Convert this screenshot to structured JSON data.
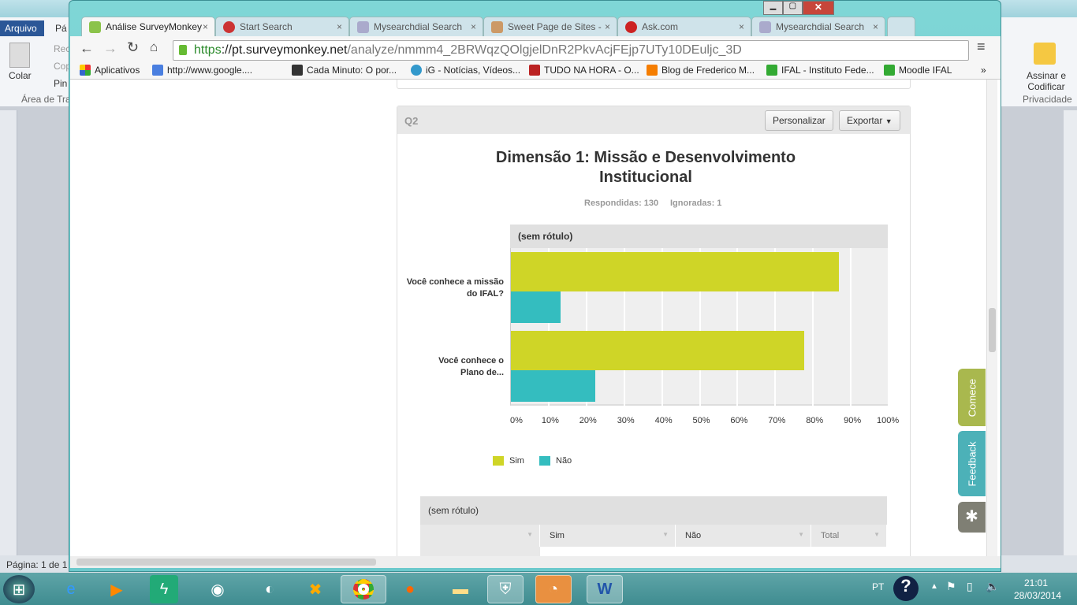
{
  "word": {
    "file_tab": "Arquivo",
    "home_tab": "Pá",
    "paste": "Colar",
    "cut": "Rec",
    "copy": "Cop",
    "painter": "Pin",
    "clipboard_group": "Área de Tra",
    "sign_encode": "Assinar e Codificar",
    "privacy_group": "Privacidade",
    "status_page": "Página: 1 de 1"
  },
  "browser": {
    "tabs": [
      {
        "label": "Análise SurveyMonkey",
        "active": true,
        "icon": "surveymonkey-icon"
      },
      {
        "label": "Start Search",
        "active": false,
        "icon": "start-search-icon"
      },
      {
        "label": "Mysearchdial Search",
        "active": false,
        "icon": "magnifier-icon"
      },
      {
        "label": "Sweet Page de Sites -",
        "active": false,
        "icon": "sweetpage-icon"
      },
      {
        "label": "Ask.com",
        "active": false,
        "icon": "ask-icon"
      },
      {
        "label": "Mysearchdial Search",
        "active": false,
        "icon": "magnifier-icon"
      }
    ],
    "url_scheme": "https",
    "url_host": "://pt.surveymonkey.net",
    "url_path": "/analyze/nmmm4_2BRWqzQOlgjelDnR2PkvAcjFEjp7UTy10DEuljc_3D",
    "bookmarks": [
      "Aplicativos",
      "http://www.google....",
      "Cada Minuto: O por...",
      "iG - Notícias, Vídeos...",
      "TUDO NA HORA - O...",
      "Blog de Frederico M...",
      "IFAL - Instituto Fede...",
      "Moodle IFAL"
    ]
  },
  "question": {
    "id": "Q2",
    "customize": "Personalizar",
    "export": "Exportar",
    "answered": "Respondidas: 130",
    "skipped": "Ignoradas: 1"
  },
  "chart_data": {
    "type": "bar",
    "orientation": "horizontal",
    "title": "Dimensão 1: Missão e Desenvolvimento Institucional",
    "group_header": "(sem rótulo)",
    "categories": [
      "Você conhece a missão do IFAL?",
      "Você conhece o Plano de..."
    ],
    "series": [
      {
        "name": "Sim",
        "color": "#cfd527",
        "values": [
          86.92,
          77.69
        ]
      },
      {
        "name": "Não",
        "color": "#34bdbf",
        "values": [
          13.08,
          22.31
        ]
      }
    ],
    "xlim": [
      0,
      100
    ],
    "ticks": [
      "0%",
      "10%",
      "20%",
      "30%",
      "40%",
      "50%",
      "60%",
      "70%",
      "80%",
      "90%",
      "100%"
    ],
    "grid": true,
    "legend": "bottom-left"
  },
  "table": {
    "header": "(sem rótulo)",
    "columns": [
      "",
      "Sim",
      "Não",
      "Total"
    ]
  },
  "side": {
    "start": "Comece",
    "feedback": "Feedback"
  },
  "tray": {
    "lang": "PT",
    "time": "21:01",
    "date": "28/03/2014"
  }
}
